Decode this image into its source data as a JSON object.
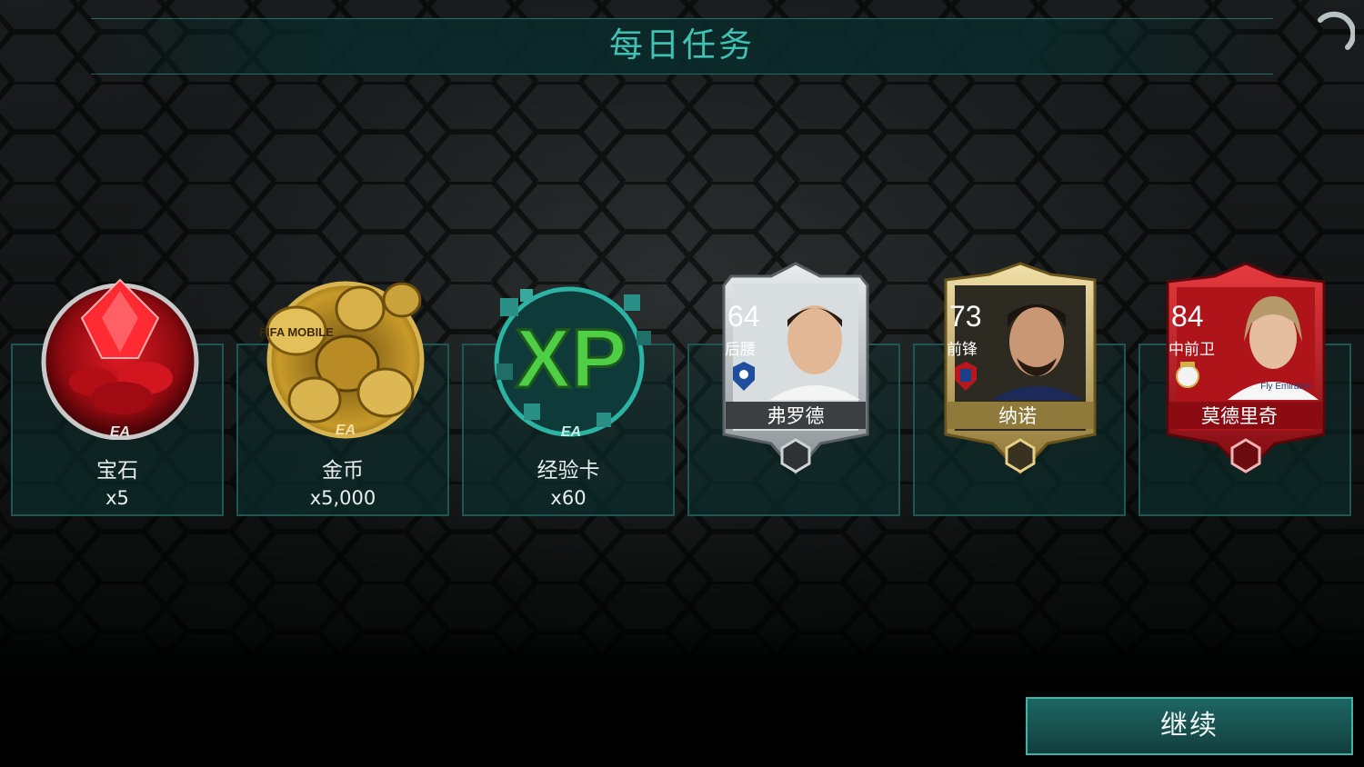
{
  "header": {
    "title": "每日任务"
  },
  "rewards": [
    {
      "name": "宝石",
      "qty": "x5",
      "badge": "EA",
      "icon": "gem-icon",
      "color": "#c8141c"
    },
    {
      "name": "金币",
      "qty": "x5,000",
      "badge": "EA",
      "icon": "coins-icon",
      "color": "#c89a2a",
      "coin_label": "FIFA MOBILE"
    },
    {
      "name": "经验卡",
      "qty": "x60",
      "badge": "EA",
      "icon": "xp-icon",
      "color": "#3fbf4a",
      "art_text": "XP"
    }
  ],
  "players": [
    {
      "rating": "64",
      "position": "后腰",
      "name": "弗罗德",
      "tier": "silver",
      "color": "#c9cdd0"
    },
    {
      "rating": "73",
      "position": "前锋",
      "name": "纳诺",
      "tier": "gold",
      "color": "#c8b060"
    },
    {
      "rating": "84",
      "position": "中前卫",
      "name": "莫德里奇",
      "tier": "red",
      "color": "#c0121e",
      "shirt_text": "Fly Emirates"
    }
  ],
  "actions": {
    "continue_label": "继续"
  },
  "colors": {
    "accent": "#3fc2b3",
    "panel": "#0d3432",
    "button": "#1d6662"
  }
}
